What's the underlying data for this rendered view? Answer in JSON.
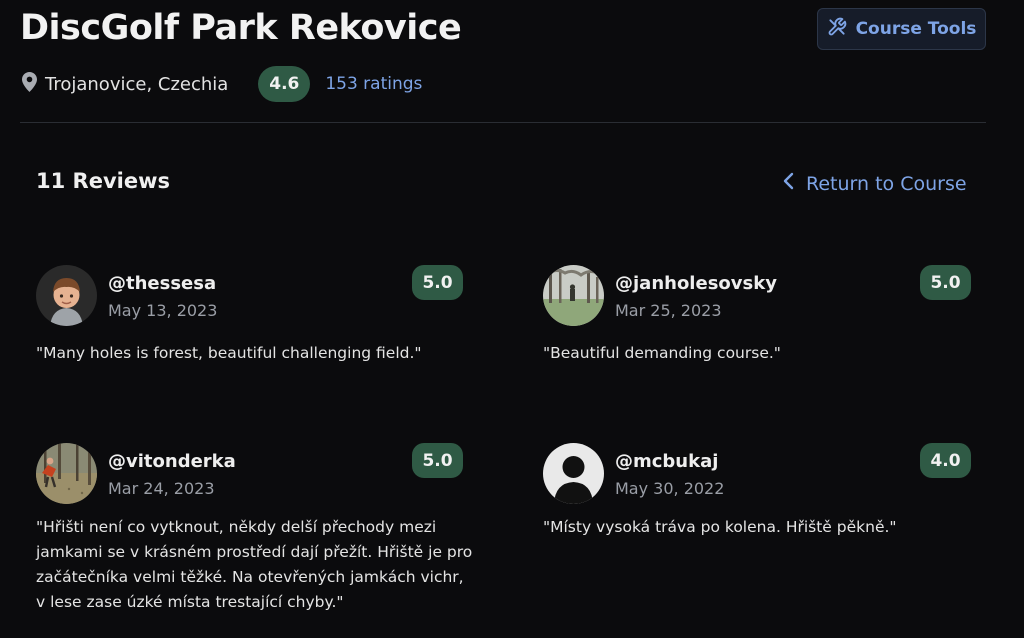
{
  "course": {
    "title": "DiscGolf Park Rekovice",
    "location": "Trojanovice, Czechia",
    "rating": "4.6",
    "ratings_count": "153 ratings"
  },
  "toolbar": {
    "course_tools_label": "Course Tools"
  },
  "reviews_section": {
    "heading": "11 Reviews",
    "return_label": "Return to Course"
  },
  "reviews": [
    {
      "username": "@thessesa",
      "date": "May 13, 2023",
      "score": "5.0",
      "text": "\"Many holes is forest, beautiful challenging field.\""
    },
    {
      "username": "@janholesovsky",
      "date": "Mar 25, 2023",
      "score": "5.0",
      "text": "\"Beautiful demanding course.\""
    },
    {
      "username": "@vitonderka",
      "date": "Mar 24, 2023",
      "score": "5.0",
      "text": "\"Hřišti není co vytknout, někdy delší přechody mezi jamkami se v krásném prostředí dají přežít. Hřiště je pro začátečníka velmi těžké. Na otevřených jamkách vichr, v lese zase úzké místa trestající chyby.\""
    },
    {
      "username": "@mcbukaj",
      "date": "May 30, 2022",
      "score": "4.0",
      "text": "\"Místy vysoká tráva po kolena. Hřiště pěkně.\""
    }
  ],
  "colors": {
    "background": "#0b0b0d",
    "accent_link": "#7ea4e6",
    "rating_pill": "#2f5a45"
  },
  "icons": {
    "course_tools": "tools-icon",
    "location": "map-pin-icon",
    "return": "chevron-left-icon"
  }
}
